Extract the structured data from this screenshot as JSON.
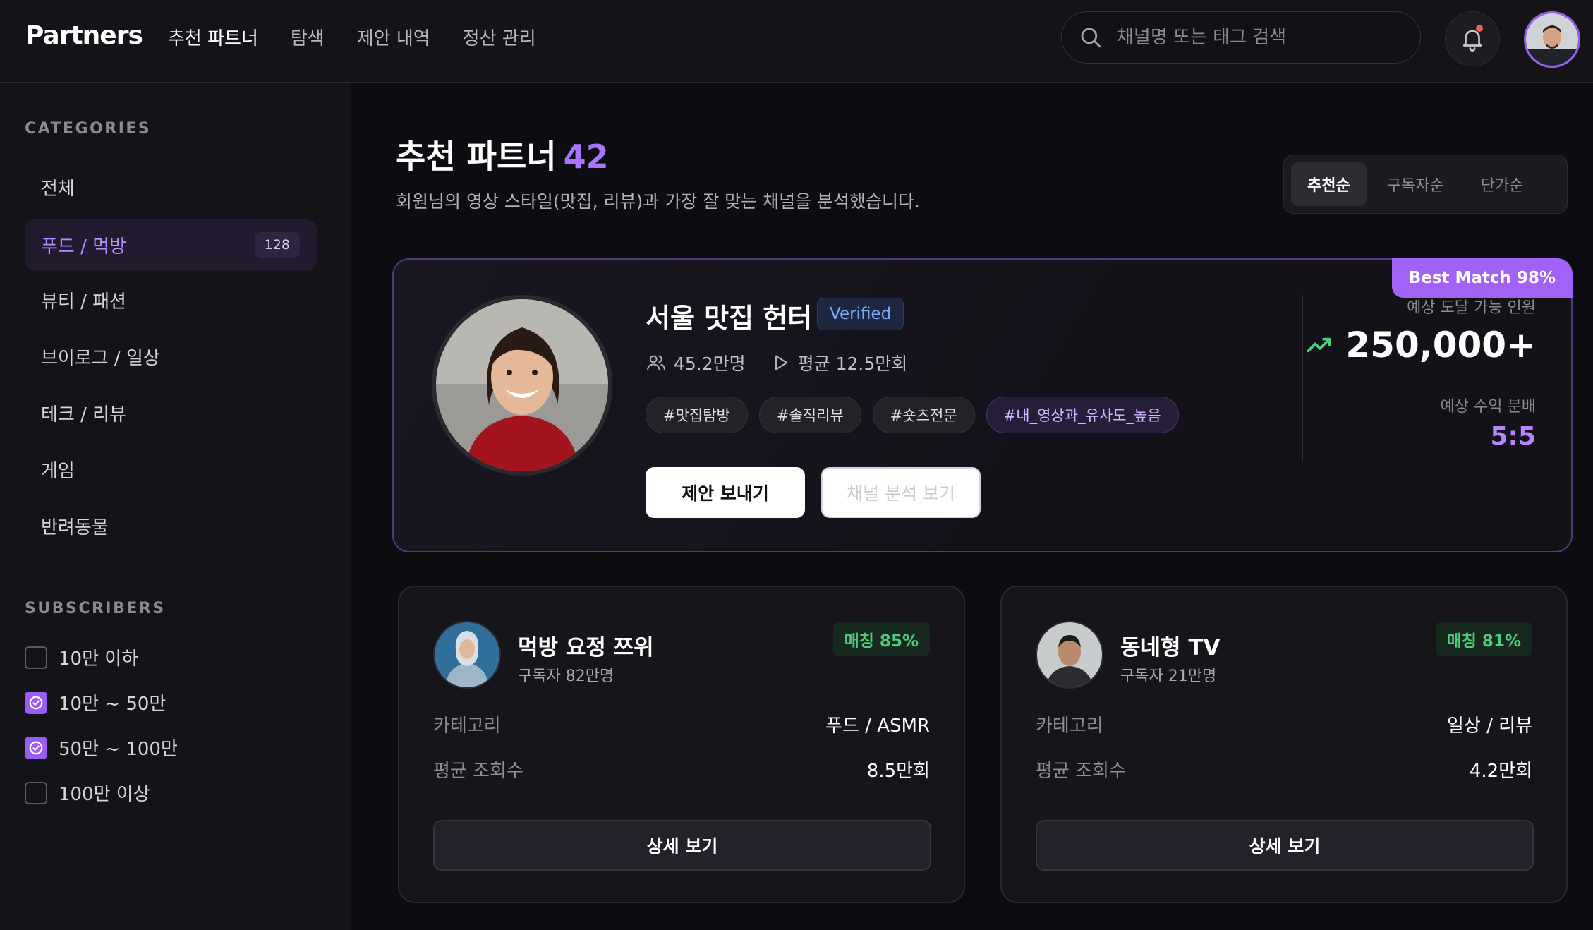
{
  "header": {
    "logo": "Partners",
    "nav": [
      "추천 파트너",
      "탐색",
      "제안 내역",
      "정산 관리"
    ],
    "active_nav": "추천 파트너",
    "search_placeholder": "채널명 또는 태그 검색"
  },
  "sidebar": {
    "categories_heading": "CATEGORIES",
    "categories": [
      {
        "label": "전체",
        "active": false
      },
      {
        "label": "푸드 / 먹방",
        "active": true,
        "count": "128"
      },
      {
        "label": "뷰티 / 패션",
        "active": false
      },
      {
        "label": "브이로그 / 일상",
        "active": false
      },
      {
        "label": "테크 / 리뷰",
        "active": false
      },
      {
        "label": "게임",
        "active": false
      },
      {
        "label": "반려동물",
        "active": false
      }
    ],
    "subscribers_heading": "SUBSCRIBERS",
    "subscriber_filters": [
      {
        "label": "10만 이하",
        "checked": false
      },
      {
        "label": "10만 ~ 50만",
        "checked": true
      },
      {
        "label": "50만 ~ 100만",
        "checked": true
      },
      {
        "label": "100만 이상",
        "checked": false
      }
    ]
  },
  "main": {
    "title": "추천 파트너",
    "count": "42",
    "subtitle": "회원님의 영상 스타일(맛집, 리뷰)과 가장 잘 맞는 채널을 분석했습니다.",
    "sort_options": [
      "추천순",
      "구독자순",
      "단가순"
    ],
    "sort_active": "추천순"
  },
  "hero": {
    "badge": "Best Match 98%",
    "name": "서울 맛집 헌터",
    "verified": "Verified",
    "subscribers": "45.2만명",
    "avg_views": "평균 12.5만회",
    "tags": [
      "#맛집탐방",
      "#솔직리뷰",
      "#숏츠전문",
      "#내_영상과_유사도_높음"
    ],
    "primary_button": "제안 보내기",
    "secondary_button": "채널 분석 보기",
    "reach_label": "예상 도달 가능 인원",
    "reach_value": "250,000+",
    "revenue_label": "예상 수익 분배",
    "revenue_value": "5:5"
  },
  "cards": [
    {
      "name": "먹방 요정 쯔위",
      "subscribers": "구독자 82만명",
      "match": "매칭 85%",
      "category_label": "카테고리",
      "category": "푸드 / ASMR",
      "views_label": "평균 조회수",
      "views": "8.5만회",
      "button": "상세 보기"
    },
    {
      "name": "동네형 TV",
      "subscribers": "구독자 21만명",
      "match": "매칭 81%",
      "category_label": "카테고리",
      "category": "일상 / 리뷰",
      "views_label": "평균 조회수",
      "views": "4.2만회",
      "button": "상세 보기"
    }
  ],
  "colors": {
    "accent": "#a262f7",
    "match_green": "#4ccf7d",
    "background": "#0d0c10",
    "panel": "#141317"
  }
}
